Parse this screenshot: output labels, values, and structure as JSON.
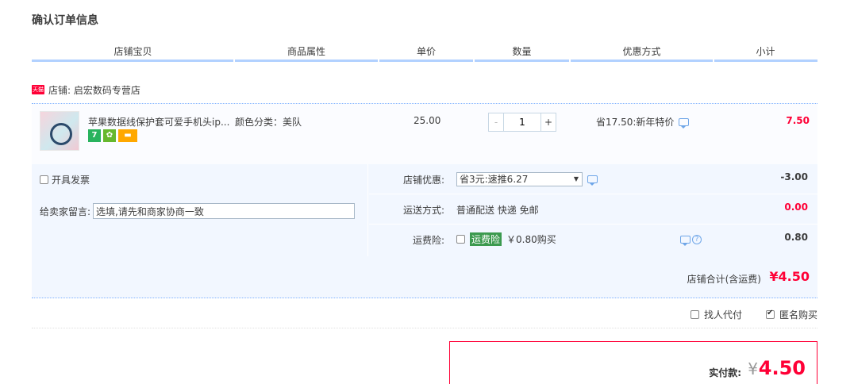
{
  "page": {
    "title": "确认订单信息"
  },
  "columns": [
    "店铺宝贝",
    "商品属性",
    "单价",
    "数量",
    "优惠方式",
    "小计"
  ],
  "shop": {
    "badge": "天猫",
    "label": "店铺: 启宏数码专营店"
  },
  "item": {
    "title": "苹果数据线保护套可爱手机头ip...",
    "sku": "颜色分类：美队",
    "price": "25.00",
    "quantity": "1",
    "qty_minus": "-",
    "qty_plus": "+",
    "badge_7": "7",
    "promo": "省17.50:新年特价",
    "subtotal": "7.50"
  },
  "options": {
    "invoice_label": "开具发票",
    "message_label": "给卖家留言:",
    "message_placeholder": "选填,请先和商家协商一致",
    "shop_discount_label": "店铺优惠:",
    "shop_discount_value": "省3元:速推6.27",
    "shop_discount_amount": "-3.00",
    "shipping_label": "运送方式:",
    "shipping_value": "普通配送 快递 免邮",
    "shipping_amount": "0.00",
    "insurance_label": "运费险:",
    "insurance_badge": "运费险",
    "insurance_value": "￥0.80购买",
    "insurance_amount": "0.80",
    "help_icon_char": "?"
  },
  "shop_total": {
    "label": "店铺合计(含运费)",
    "amount": "¥4.50"
  },
  "extra": {
    "pay_for_me": "找人代付",
    "anonymous": "匿名购买"
  },
  "payment": {
    "label": "实付款:",
    "currency": "¥",
    "amount": "4.50"
  },
  "colors": {
    "accent_red": "#ff0036",
    "header_border": "#b2d1ff",
    "panel_bg": "#f2f7ff"
  }
}
